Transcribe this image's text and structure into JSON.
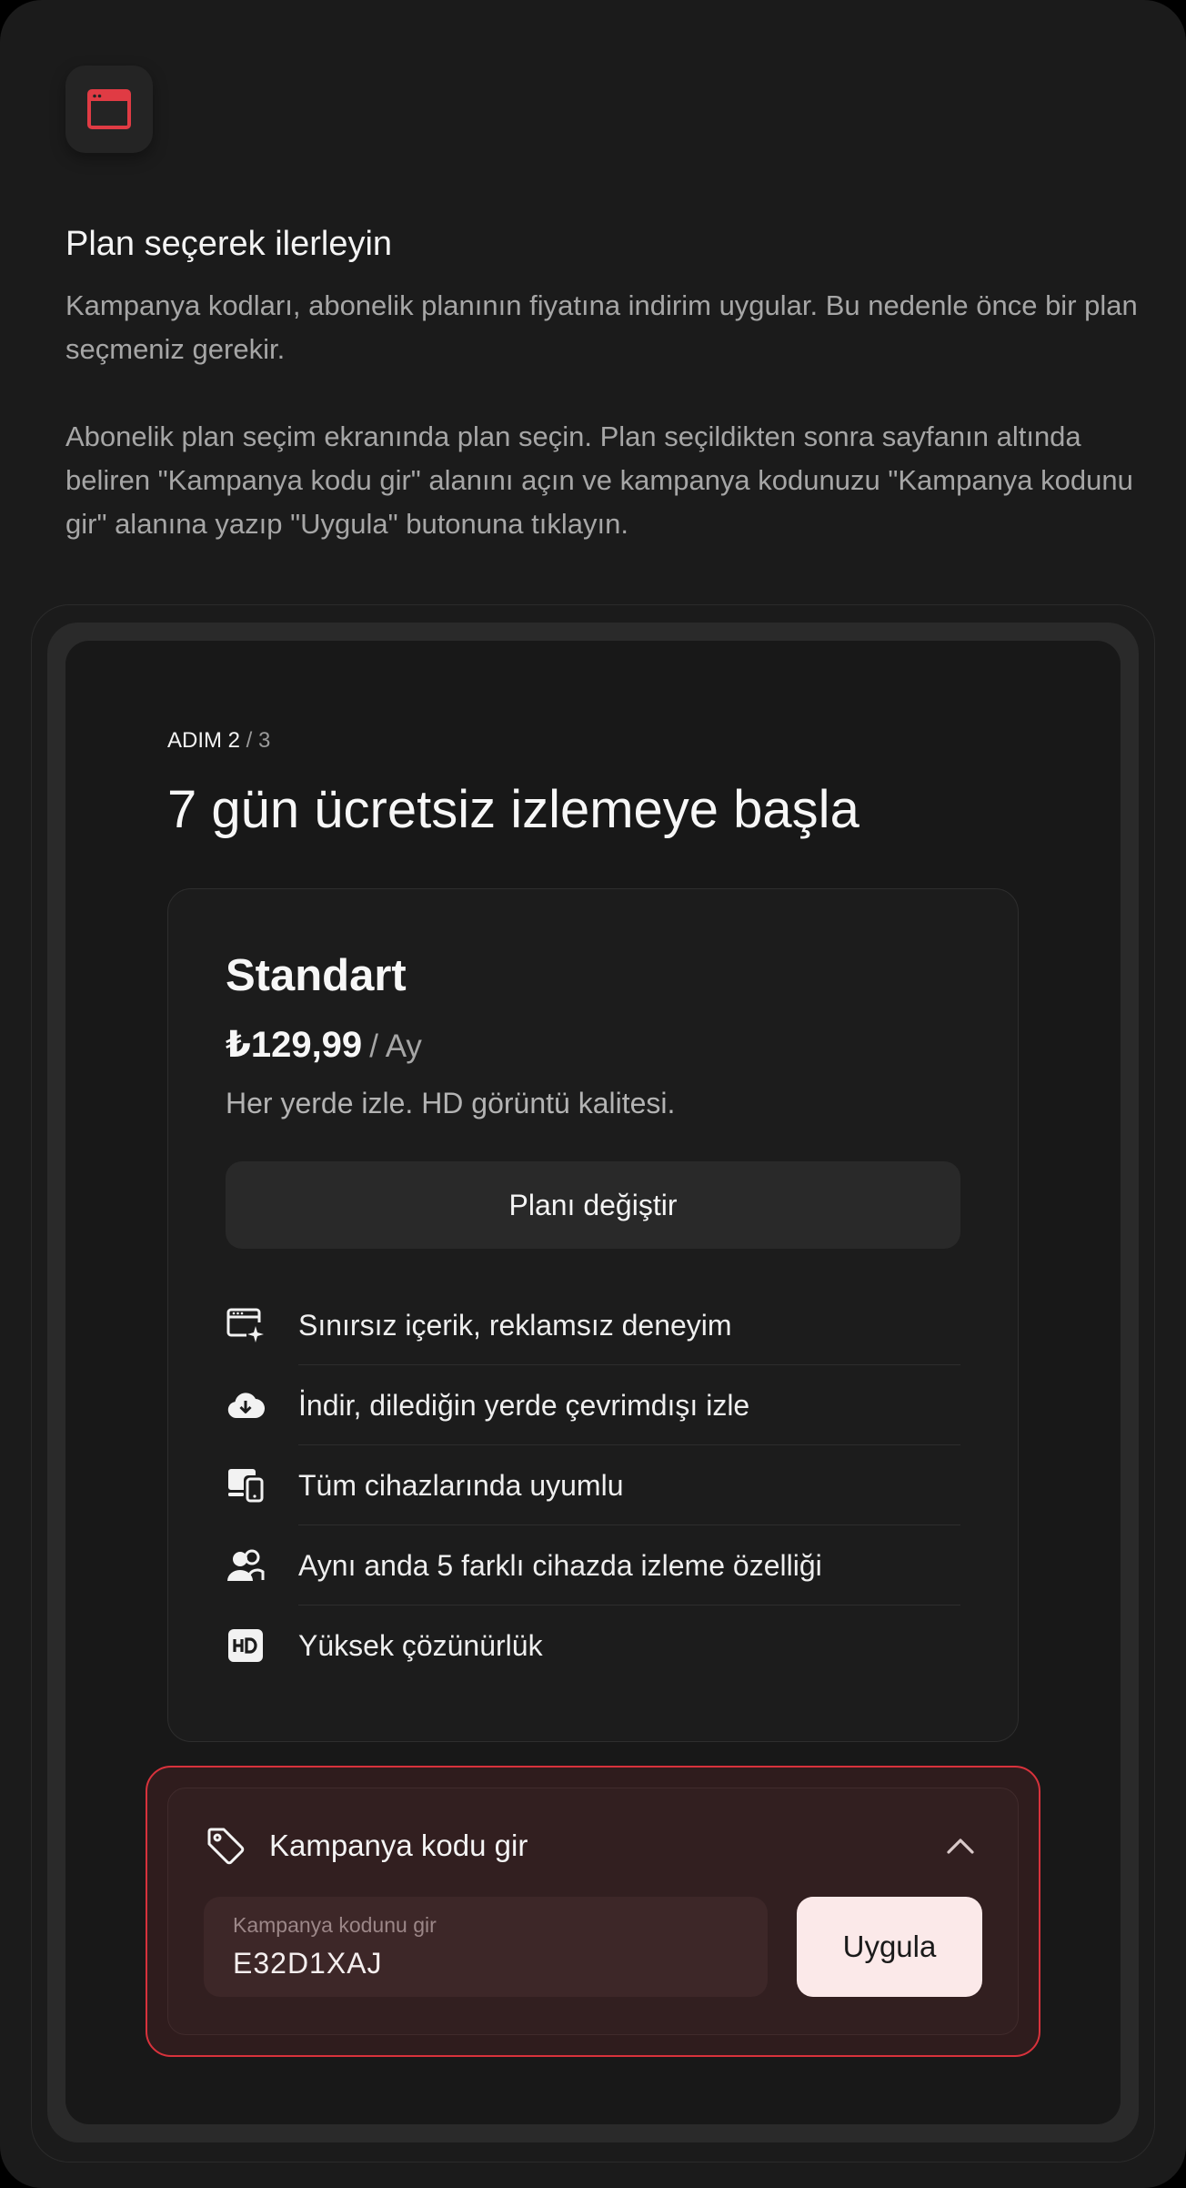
{
  "intro": {
    "title": "Plan seçerek ilerleyin",
    "paragraph1": "Kampanya kodları, abonelik planının fiyatına indirim uygular. Bu nedenle önce bir plan seçmeniz gerekir.",
    "paragraph2": "Abonelik plan seçim ekranında plan seçin. Plan seçildikten sonra sayfanın altında beliren \"Kampanya kodu gir\" alanını açın ve kampanya kodunuzu \"Kampanya kodunu gir\" alanına yazıp \"Uygula\" butonuna tıklayın."
  },
  "step": {
    "current": "ADIM 2",
    "total": " / 3"
  },
  "headline": "7 gün ücretsiz izlemeye başla",
  "plan": {
    "name": "Standart",
    "price": "₺129,99",
    "period": "/ Ay",
    "description": "Her yerde izle. HD görüntü kalitesi.",
    "change_button": "Planı değiştir",
    "features": [
      {
        "icon": "screen-sparkle-icon",
        "label": "Sınırsız içerik, reklamsız deneyim"
      },
      {
        "icon": "cloud-download-icon",
        "label": "İndir, dilediğin yerde çevrimdışı izle"
      },
      {
        "icon": "devices-icon",
        "label": "Tüm cihazlarında uyumlu"
      },
      {
        "icon": "users-icon",
        "label": "Aynı anda 5 farklı cihazda izleme özelliği"
      },
      {
        "icon": "hd-icon",
        "label": "Yüksek çözünürlük"
      }
    ]
  },
  "promo": {
    "title": "Kampanya kodu gir",
    "field_label": "Kampanya kodunu gir",
    "code_value": "E32D1XAJ",
    "apply_button": "Uygula"
  },
  "colors": {
    "background": "#1b1b1b",
    "accent_red": "#e03b44",
    "promo_border": "#d8323c",
    "apply_button_bg": "#fbe9e9"
  }
}
